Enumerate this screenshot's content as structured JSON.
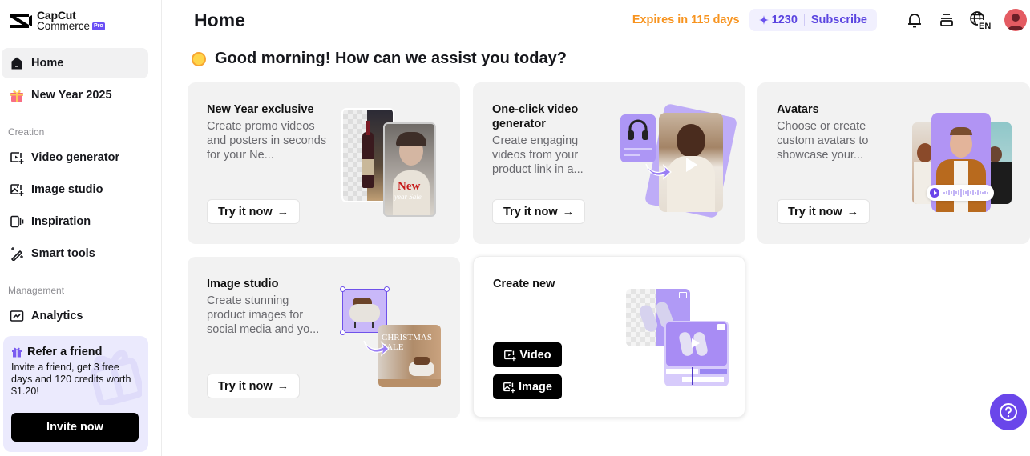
{
  "brand": {
    "name_line1": "CapCut",
    "name_line2": "Commerce",
    "badge": "Pro"
  },
  "sidebar": {
    "items_top": [
      {
        "label": "Home",
        "icon": "home-icon",
        "active": true
      },
      {
        "label": "New Year 2025",
        "icon": "gift-icon",
        "active": false
      }
    ],
    "sections": [
      {
        "label": "Creation",
        "items": [
          {
            "label": "Video generator",
            "icon": "video-sparkle-icon"
          },
          {
            "label": "Image studio",
            "icon": "image-sparkle-icon"
          },
          {
            "label": "Inspiration",
            "icon": "inspiration-icon"
          },
          {
            "label": "Smart tools",
            "icon": "magic-wand-icon"
          }
        ]
      },
      {
        "label": "Management",
        "items": [
          {
            "label": "Analytics",
            "icon": "analytics-icon"
          }
        ]
      }
    ],
    "refer": {
      "title": "Refer a friend",
      "text": "Invite a friend, get 3 free days and 120 credits worth $1.20!",
      "button": "Invite now"
    }
  },
  "header": {
    "title": "Home",
    "expires": "Expires in 115 days",
    "credits": "1230",
    "subscribe": "Subscribe",
    "language": "EN"
  },
  "greeting": "Good morning! How can we assist you today?",
  "cards": [
    {
      "title": "New Year exclusive",
      "desc": "Create promo videos and posters in seconds for your Ne...",
      "button": "Try it now"
    },
    {
      "title": "One-click video generator",
      "desc": "Create engaging videos from your product link in a...",
      "button": "Try it now"
    },
    {
      "title": "Avatars",
      "desc": "Choose or create custom avatars to showcase your...",
      "button": "Try it now"
    },
    {
      "title": "Image studio",
      "desc": "Create stunning product images for social media and yo...",
      "button": "Try it now"
    }
  ],
  "create_new": {
    "title": "Create new",
    "video_button": "Video",
    "image_button": "Image"
  },
  "illustrations": {
    "poster_text_1": "New",
    "poster_text_2": "year Sale",
    "christmas_text": "CHRISTMAS SALE"
  },
  "colors": {
    "accent": "#6a46ea",
    "expires": "#f7931e",
    "credits_text": "#5b45e0",
    "card_bg": "#f2f2f2"
  }
}
